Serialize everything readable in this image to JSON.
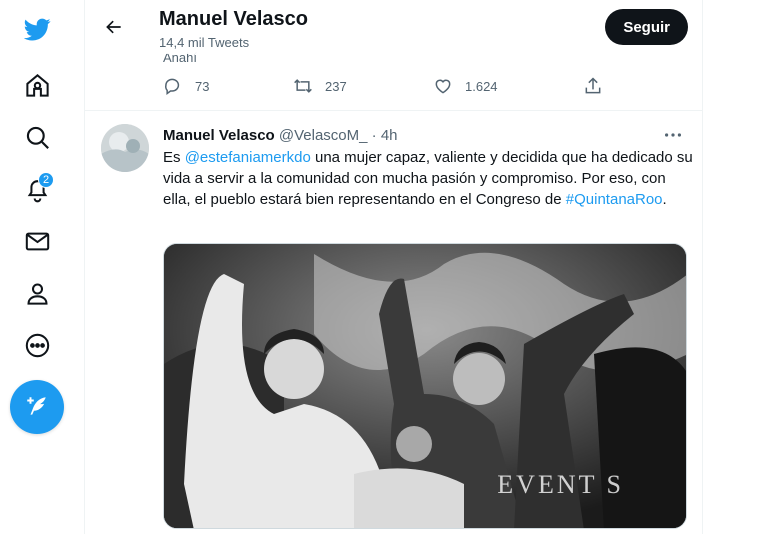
{
  "nav": {
    "notifications_badge": "2",
    "items": [
      {
        "name": "twitter-logo-icon"
      },
      {
        "name": "home-icon"
      },
      {
        "name": "explore-icon"
      },
      {
        "name": "notifications-icon"
      },
      {
        "name": "messages-icon"
      },
      {
        "name": "profile-icon"
      },
      {
        "name": "more-icon"
      },
      {
        "name": "compose-tweet-icon"
      }
    ]
  },
  "header": {
    "title": "Manuel Velasco",
    "subtitle": "14,4 mil Tweets",
    "follow_label": "Seguir"
  },
  "previous_tweet": {
    "cut_text": "Anahí",
    "replies": "73",
    "retweets": "237",
    "likes": "1.624"
  },
  "tweet": {
    "name": "Manuel Velasco",
    "handle": "@VelascoM_",
    "dot": "·",
    "time": "4h",
    "text_prefix": "Es ",
    "mention": "@estefaniamerkdo",
    "text_body": " una mujer capaz, valiente y decidida que ha dedicado su vida a servir a la comunidad con mucha pasión y compromiso. Por eso, con ella, el pueblo estará bien representando en el Congreso de ",
    "hashtag": "#QuintanaRoo",
    "text_suffix": ".",
    "media_watermark": "EVENT S"
  },
  "colors": {
    "accent": "#1d9bf0",
    "text_primary": "#0f1419",
    "text_secondary": "#536471",
    "follow_bg": "#0f1419"
  }
}
